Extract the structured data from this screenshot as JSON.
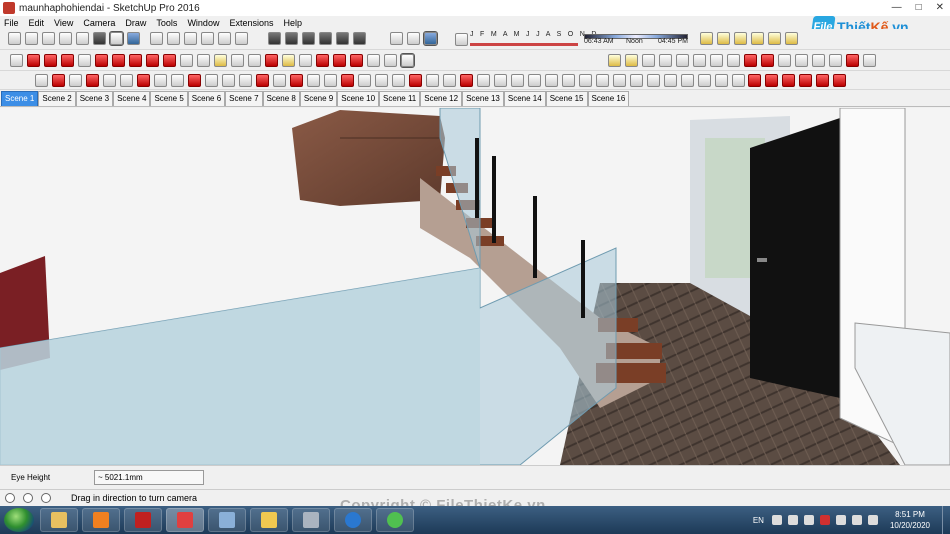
{
  "window": {
    "title": "maunhaphohiendai - SketchUp Pro 2016",
    "minimize": "—",
    "maximize": "□",
    "close": "✕"
  },
  "menu": [
    "File",
    "Edit",
    "View",
    "Camera",
    "Draw",
    "Tools",
    "Window",
    "Extensions",
    "Help"
  ],
  "shadows": {
    "months": "J F M A M J J A S O N D",
    "time_start": "06:43 AM",
    "time_mid": "Noon",
    "time_end": "04:45 PM"
  },
  "logo": {
    "box": "File",
    "name_a": "Thiết",
    "name_b": "Kế",
    "suffix": ".vn"
  },
  "scenes": {
    "active_index": 0,
    "tabs": [
      "Scene 1",
      "Scene 2",
      "Scene 3",
      "Scene 4",
      "Scene 5",
      "Scene 6",
      "Scene 7",
      "Scene 8",
      "Scene 9",
      "Scene 10",
      "Scene 11",
      "Scene 12",
      "Scene 13",
      "Scene 14",
      "Scene 15",
      "Scene 16"
    ]
  },
  "measurements": {
    "label": "Eye Height",
    "value": "~ 5021.1mm"
  },
  "status": {
    "text": "Drag in direction to turn camera"
  },
  "watermark": "Copyright © FileThietKe.vn",
  "taskbar": {
    "apps": [
      "file-explorer",
      "media-player",
      "autocad",
      "sketchup",
      "monitor",
      "folder",
      "calculator",
      "imo",
      "browser"
    ],
    "language": "EN",
    "time": "8:51 PM",
    "date": "10/20/2020"
  },
  "colors": {
    "scene_active": "#3c8ee6",
    "taskbar": "#1d3a57",
    "floor": "#5a4a40",
    "glass": "#a8c8d8",
    "tread": "#7a3e26"
  }
}
